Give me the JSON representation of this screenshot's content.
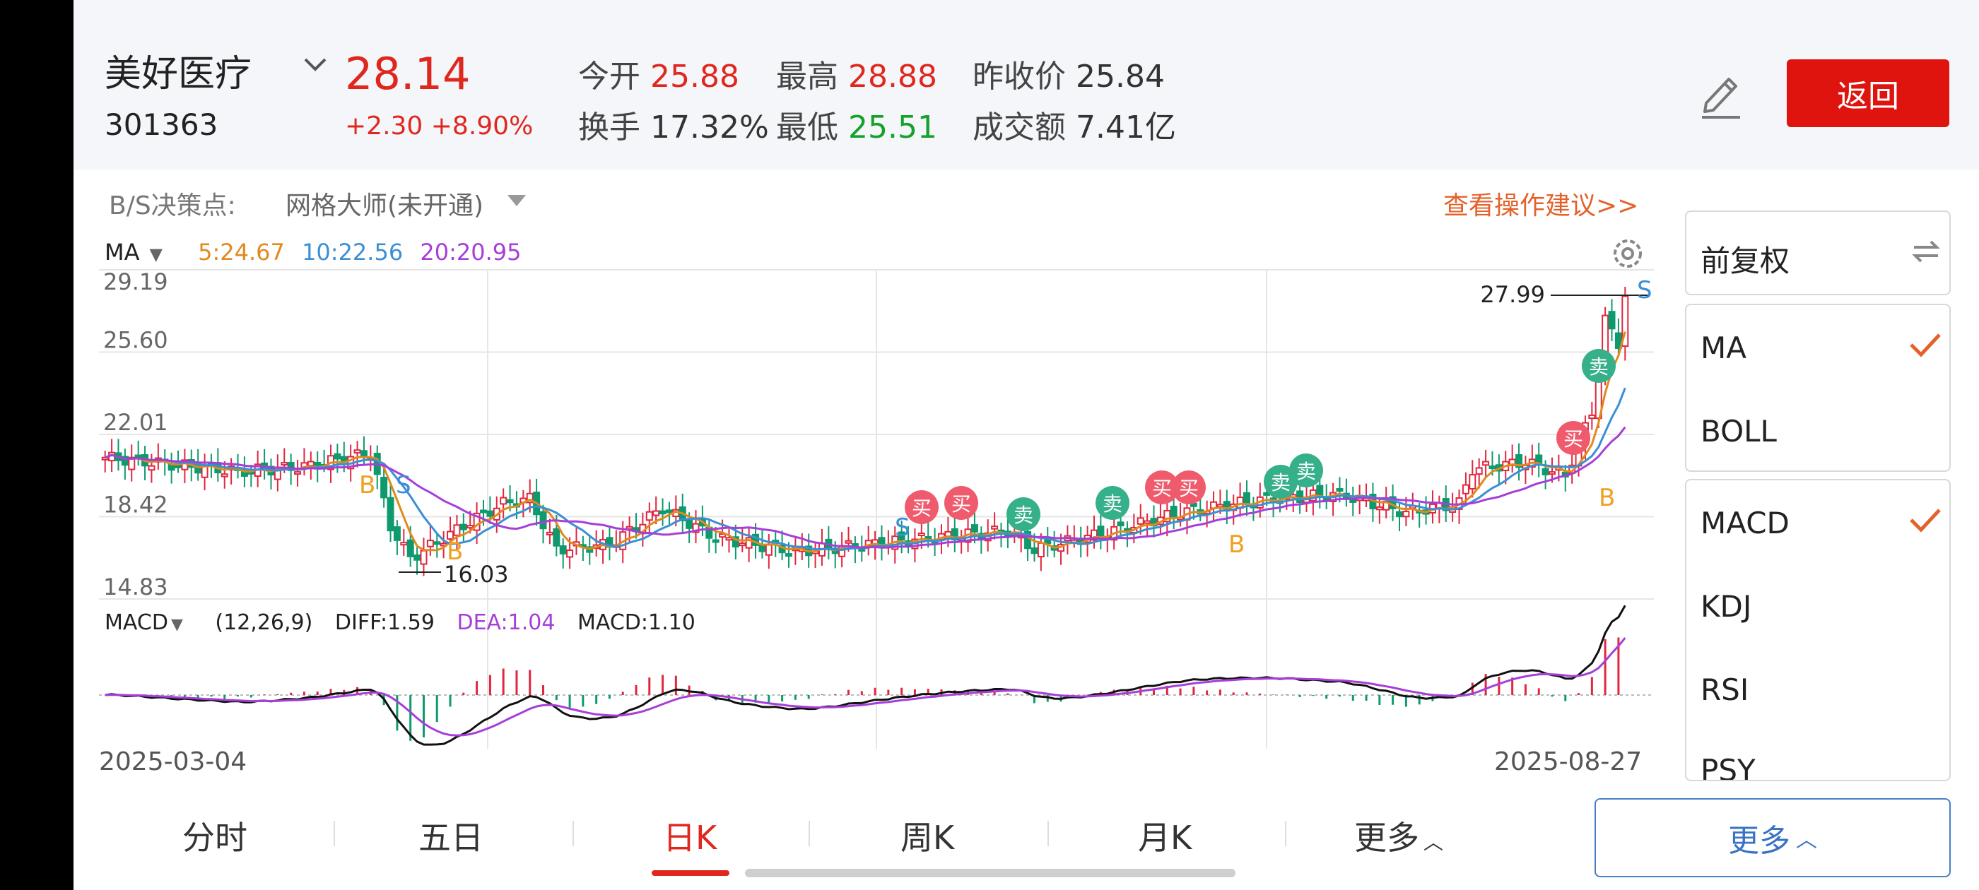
{
  "stock": {
    "name": "美好医疗",
    "code": "301363",
    "price": "28.14",
    "change": "+2.30 +8.90%"
  },
  "quotes": {
    "open_label": "今开",
    "open": "25.88",
    "high_label": "最高",
    "high": "28.88",
    "prev_label": "昨收价",
    "prev": "25.84",
    "turnover_label": "换手",
    "turnover": "17.32%",
    "low_label": "最低",
    "low": "25.51",
    "volume_label": "成交额",
    "volume": "7.41亿"
  },
  "header": {
    "back_label": "返回"
  },
  "decision": {
    "label": "B/S决策点:",
    "strategy": "网格大师(未开通)",
    "advice_link": "查看操作建议>>"
  },
  "ma": {
    "label": "MA",
    "ma5": "5:24.67",
    "ma10": "10:22.56",
    "ma20": "20:20.95",
    "colors": {
      "ma5": "#e08a1e",
      "ma10": "#3a8fd6",
      "ma20": "#a63fd8"
    }
  },
  "macd": {
    "label": "MACD",
    "params": "(12,26,9)",
    "diff": "DIFF:1.59",
    "dea": "DEA:1.04",
    "macd": "MACD:1.10"
  },
  "chart_data": {
    "type": "candlestick",
    "y_ticks": [
      "29.19",
      "25.60",
      "22.01",
      "18.42",
      "14.83"
    ],
    "ylim": [
      14.83,
      29.19
    ],
    "x_start": "2025-03-04",
    "x_end": "2025-08-27",
    "high_marker": "27.99",
    "low_marker": "16.03",
    "signal_buy_text": "买",
    "signal_sell_text": "卖",
    "marker_b": "B",
    "marker_s": "S",
    "colors": {
      "up": "#e0273e",
      "down": "#0f9a6e"
    }
  },
  "right_panel": {
    "adjust": "前复权",
    "indicators_main": [
      {
        "label": "MA",
        "checked": true
      },
      {
        "label": "BOLL",
        "checked": false
      }
    ],
    "indicators_sub": [
      {
        "label": "MACD",
        "checked": true
      },
      {
        "label": "KDJ",
        "checked": false
      },
      {
        "label": "RSI",
        "checked": false
      },
      {
        "label": "PSY",
        "checked": false
      }
    ]
  },
  "tabs": [
    "分时",
    "五日",
    "日K",
    "周K",
    "月K",
    "更多"
  ],
  "more_button": "更多"
}
